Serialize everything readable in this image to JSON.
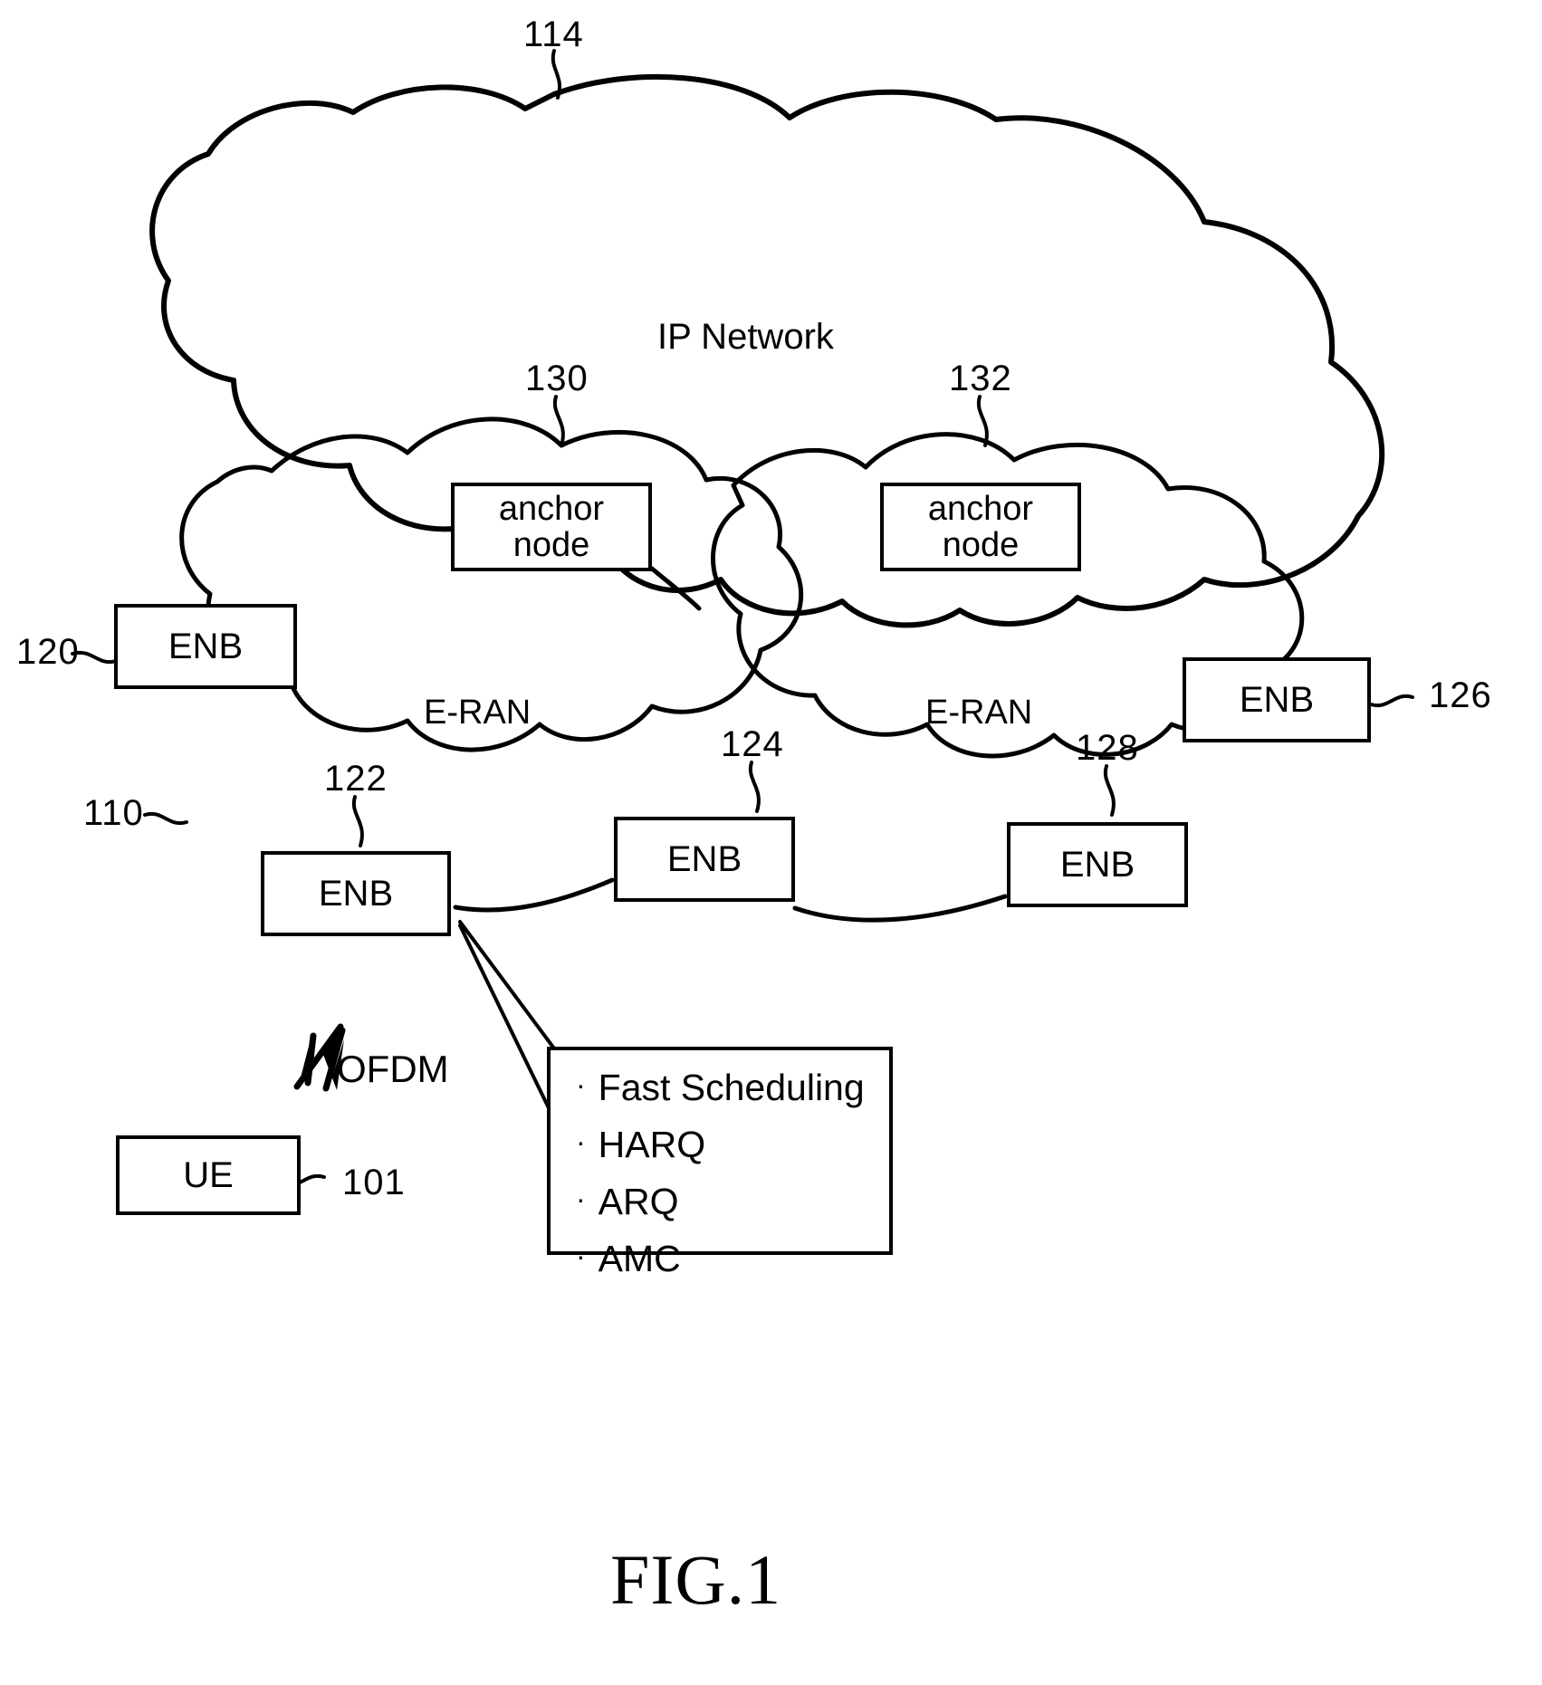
{
  "figure": {
    "caption": "FIG.1",
    "title_text": "IP Network"
  },
  "clouds": {
    "ip_network": {
      "label": "IP Network",
      "ref": "114"
    },
    "eran_left": {
      "label": "E-RAN",
      "ref": "110"
    },
    "eran_right": {
      "label": "E-RAN",
      "ref": ""
    }
  },
  "nodes": [
    {
      "id": "anchor-node-130",
      "label_line1": "anchor",
      "label_line2": "node",
      "ref": "130"
    },
    {
      "id": "anchor-node-132",
      "label_line1": "anchor",
      "label_line2": "node",
      "ref": "132"
    },
    {
      "id": "enb-120",
      "label": "ENB",
      "ref": "120"
    },
    {
      "id": "enb-122",
      "label": "ENB",
      "ref": "122"
    },
    {
      "id": "enb-124",
      "label": "ENB",
      "ref": "124"
    },
    {
      "id": "enb-126",
      "label": "ENB",
      "ref": "126"
    },
    {
      "id": "enb-128",
      "label": "ENB",
      "ref": "128"
    },
    {
      "id": "ue-101",
      "label": "UE",
      "ref": "101"
    }
  ],
  "radio_link": {
    "label": "OFDM",
    "icon": "lightning-bolt-icon"
  },
  "callout": {
    "items": [
      "Fast Scheduling",
      "HARQ",
      "ARQ",
      "AMC"
    ],
    "bullet": "·"
  },
  "colors": {
    "stroke": "#000000",
    "background": "#ffffff"
  }
}
